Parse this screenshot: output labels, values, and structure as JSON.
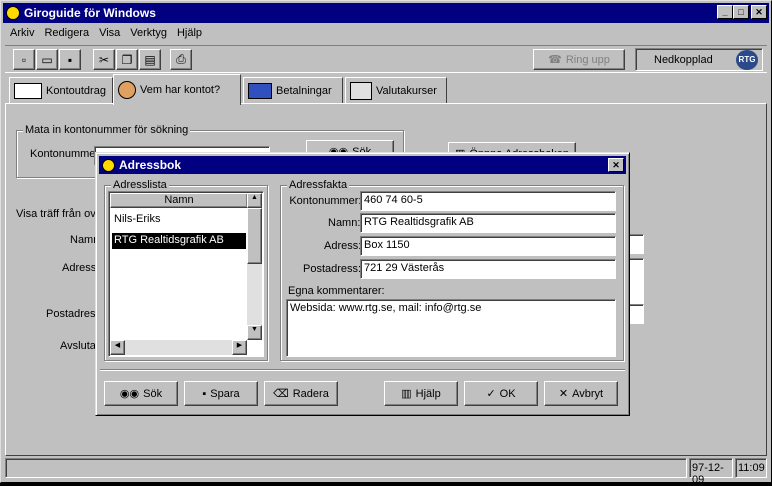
{
  "app": {
    "title": "Giroguide för Windows"
  },
  "menu": [
    "Arkiv",
    "Redigera",
    "Visa",
    "Verktyg",
    "Hjälp"
  ],
  "toolbar": {
    "ring_label": "Ring upp",
    "connection": "Nedkopplad",
    "logo": "RTG"
  },
  "tabs": [
    {
      "label": "Kontoutdrag"
    },
    {
      "label": "Vem har kontot?"
    },
    {
      "label": "Betalningar"
    },
    {
      "label": "Valutakurser"
    }
  ],
  "main": {
    "search_group": "Mata in kontonummer för sökning",
    "kontonummer_label": "Kontonummer:",
    "search_button": "Sök",
    "open_book_button": "Öppna Adressboken",
    "visa_label": "Visa träff från ov",
    "namn_label": "Namn",
    "adress_label": "Adress",
    "postadress_label": "Postadress",
    "avsluta_label": "Avsluta"
  },
  "status": {
    "date": "97-12-09",
    "time": "11:09"
  },
  "dialog": {
    "title": "Adressbok",
    "list_group": "Adresslista",
    "list_header": "Namn",
    "list_items": [
      "Nils-Eriks",
      "RTG Realtidsgrafik AB"
    ],
    "facts_group": "Adressfakta",
    "kontonummer_label": "Kontonummer:",
    "kontonummer": "460 74 60-5",
    "namn_label": "Namn:",
    "namn": "RTG Realtidsgrafik AB",
    "adress_label": "Adress:",
    "adress": "Box 1150",
    "postadress_label": "Postadress:",
    "postadress": "721 29 Västerås",
    "comments_label": "Egna kommentarer:",
    "comments": "Websida: www.rtg.se, mail: info@rtg.se",
    "buttons": {
      "sok": "Sök",
      "spara": "Spara",
      "radera": "Radera",
      "hjalp": "Hjälp",
      "ok": "OK",
      "avbryt": "Avbryt"
    }
  }
}
